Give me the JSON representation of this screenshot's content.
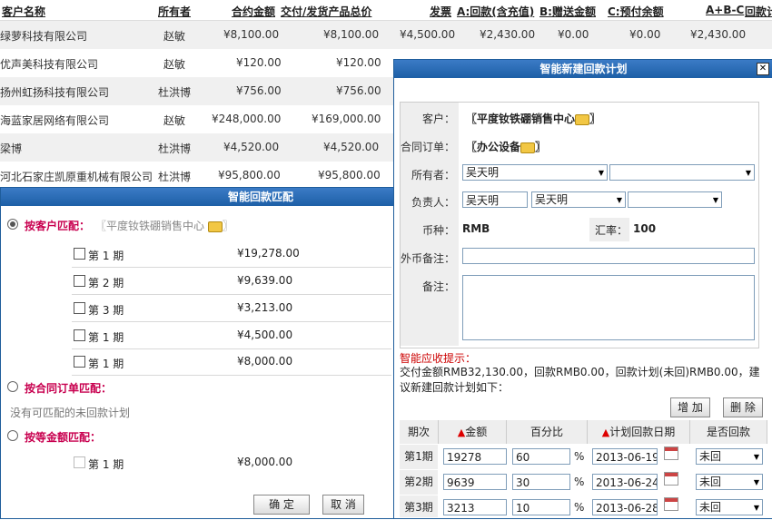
{
  "table": {
    "headers": [
      "客户名称",
      "所有者",
      "合约金额",
      "交付/发货产品总价",
      "发票",
      "A:回款(含充值)",
      "B:赠送金额",
      "C:预付余额",
      "A+B-C",
      "回款计"
    ],
    "rows": [
      {
        "name": "绿萝科技有限公司",
        "owner": "赵敏",
        "contract": "¥8,100.00",
        "delivery": "¥8,100.00",
        "invoice": "¥4,500.00",
        "a": "¥2,430.00",
        "b": "¥0.00",
        "c": "¥0.00",
        "abc": "¥2,430.00"
      },
      {
        "name": "优声美科技有限公司",
        "owner": "赵敏",
        "contract": "¥120.00",
        "delivery": "¥120.00"
      },
      {
        "name": "扬州虹扬科技有限公司",
        "owner": "杜洪博",
        "contract": "¥756.00",
        "delivery": "¥756.00"
      },
      {
        "name": "海蓝家居网络有限公司",
        "owner": "赵敏",
        "contract": "¥248,000.00",
        "delivery": "¥169,000.00"
      },
      {
        "name": "梁博",
        "owner": "杜洪博",
        "contract": "¥4,520.00",
        "delivery": "¥4,520.00"
      },
      {
        "name": "河北石家庄凯原重机械有限公司",
        "owner": "杜洪博",
        "contract": "¥95,800.00",
        "delivery": "¥95,800.00"
      }
    ]
  },
  "match_dialog": {
    "title": "智能回款匹配",
    "by_customer_label": "按客户匹配：",
    "customer_value": "〖平度钕铁硼销售中心",
    "customer_periods": [
      {
        "label": "第 1 期",
        "amount": "¥19,278.00"
      },
      {
        "label": "第 2 期",
        "amount": "¥9,639.00"
      },
      {
        "label": "第 3 期",
        "amount": "¥3,213.00"
      },
      {
        "label": "第 1 期",
        "amount": "¥4,500.00"
      },
      {
        "label": "第 1 期",
        "amount": "¥8,000.00"
      }
    ],
    "by_order_label": "按合同订单匹配：",
    "no_plan_text": "没有可匹配的未回款计划",
    "by_amount_label": "按等金额匹配：",
    "amount_periods": [
      {
        "label": "第 1 期",
        "amount": "¥8,000.00"
      }
    ],
    "ok_label": "确 定",
    "cancel_label": "取 消"
  },
  "plan_dialog": {
    "title": "智能新建回款计划",
    "customer_label": "客户：",
    "customer_value": "〖平度钕铁硼销售中心",
    "order_label": "合同订单：",
    "order_value": "〖办公设备",
    "owner_label": "所有者：",
    "owner_value": "吴天明",
    "owner_value2": "",
    "resp_label": "负责人：",
    "resp_input": "吴天明",
    "resp_select": "吴天明",
    "resp_select2": "",
    "currency_label": "币种：",
    "currency_value": "RMB",
    "rate_label": "汇率：",
    "rate_value": "100",
    "fx_note_label": "外币备注：",
    "fx_note_value": "",
    "note_label": "备注：",
    "note_value": "",
    "tip_title": "智能应收提示：",
    "tip_text": "交付金额RMB32,130.00，回款RMB0.00，回款计划(未回)RMB0.00，建议新建回款计划如下：",
    "add_label": "增 加",
    "delete_label": "删 除",
    "col_period": "期次",
    "col_amount": "金额",
    "col_percent": "百分比",
    "col_date": "计划回款日期",
    "col_returned": "是否回款",
    "percent_sign": "%",
    "rows": [
      {
        "period": "第1期",
        "amount": "19278",
        "percent": "60",
        "date": "2013-06-19",
        "returned": "未回"
      },
      {
        "period": "第2期",
        "amount": "9639",
        "percent": "30",
        "date": "2013-06-24",
        "returned": "未回"
      },
      {
        "period": "第3期",
        "amount": "3213",
        "percent": "10",
        "date": "2013-06-28",
        "returned": "未回"
      }
    ]
  }
}
